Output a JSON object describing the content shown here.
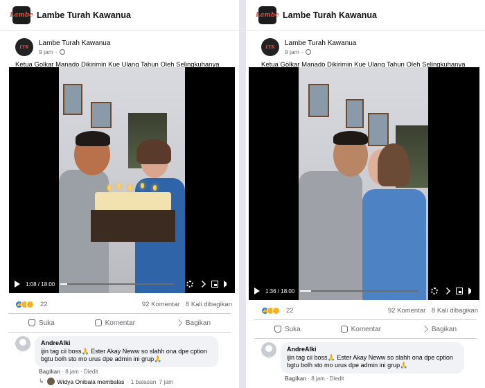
{
  "page_name": "Lambe Turah Kawanua",
  "logo_text": "Lambe Turah Kawanua",
  "post": {
    "author": "Lambe Turah Kawanua",
    "time": "9 jam",
    "caption": "Ketua Golkar Manado Dikirimin Kue Ulang Tahun Oleh Selingkuhanya",
    "reaction_count": "22",
    "comments": "92 Komentar",
    "shares": "8 Kali dibagikan"
  },
  "actions": {
    "like": "Suka",
    "comment": "Komentar",
    "share": "Bagikan"
  },
  "comment": {
    "author": "AndreAlki",
    "text": "ijin tag cii boss🙏 Ester Akay Neww so slahh ona dpe cption bgtu bolh sto mo urus dpe admin ini grup🙏",
    "share_label": "Bagikan",
    "meta": "· 8 jam · Diedit"
  },
  "reply": {
    "name": "Widya Onibala membalas",
    "info": "· 1 balasan",
    "time": "7 jam"
  },
  "videos": [
    {
      "time": "1:08 / 18:00",
      "progress": 0.06
    },
    {
      "time": "1:36 / 18:00",
      "progress": 0.09
    }
  ],
  "colors": {
    "accent": "#1877f2",
    "secondary_text": "#65676b"
  },
  "icons": [
    "globe-icon",
    "play-icon",
    "gear-icon",
    "expand-icon",
    "pip-icon",
    "volume-icon",
    "thumb-icon",
    "comment-icon",
    "share-icon",
    "reply-arrow-icon"
  ]
}
